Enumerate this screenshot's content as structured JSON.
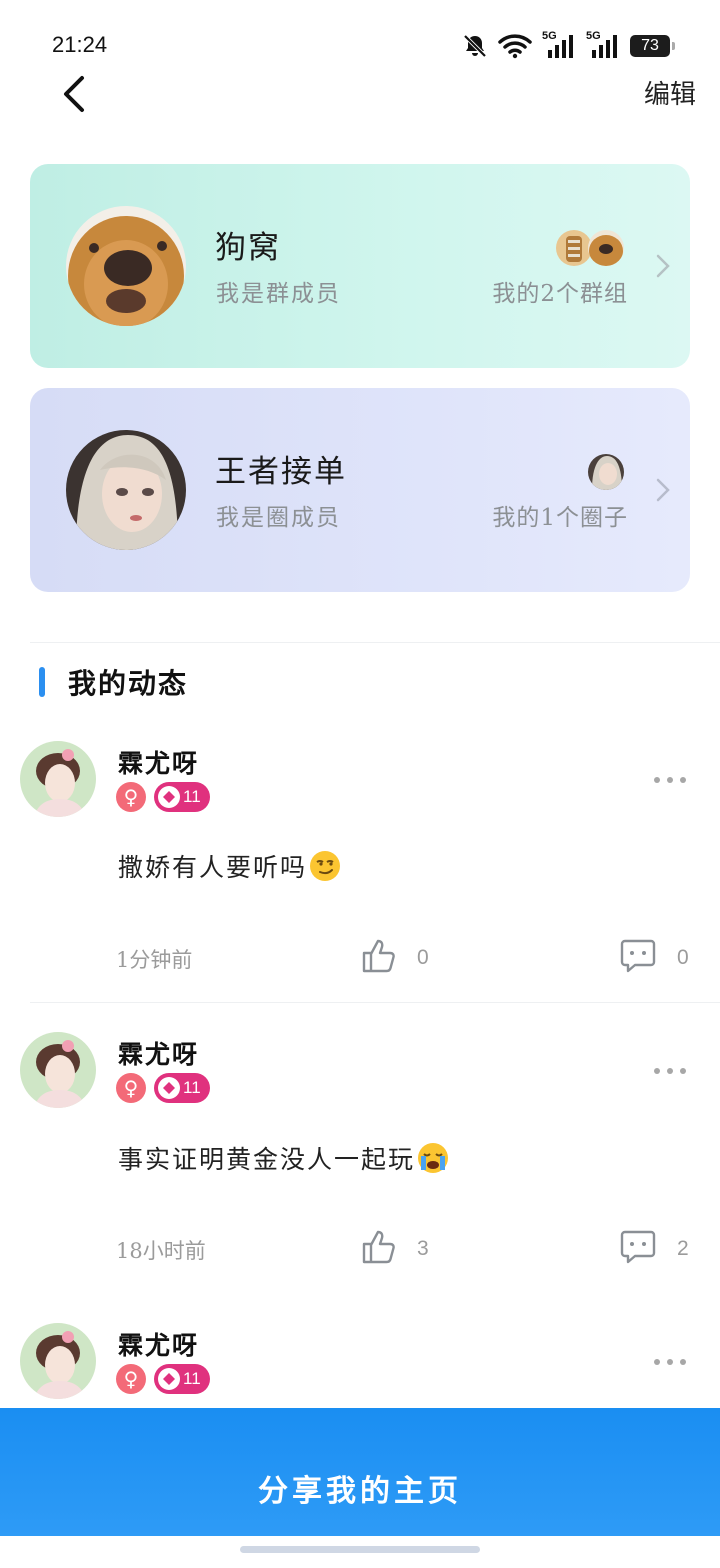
{
  "status_bar": {
    "time": "21:24",
    "signal_1": "5G",
    "signal_2": "5G",
    "battery": "73"
  },
  "header": {
    "edit_label": "编辑"
  },
  "group_card": {
    "title": "狗窝",
    "subtitle": "我是群成员",
    "right_label": "我的2个群组",
    "bg_color": "#c9f2ea"
  },
  "circle_card": {
    "title": "王者接单",
    "subtitle": "我是圈成员",
    "right_label": "我的1个圈子",
    "bg_color": "#dbe0f8"
  },
  "section": {
    "title": "我的动态",
    "accent": "#2b8ff0"
  },
  "posts": [
    {
      "user": "霖尤呀",
      "gender": "♀",
      "level": "11",
      "content": "撒娇有人要听吗",
      "emoji": "smirk-emoji",
      "time": "1分钟前",
      "likes": "0",
      "comments": "0"
    },
    {
      "user": "霖尤呀",
      "gender": "♀",
      "level": "11",
      "content": "事实证明黄金没人一起玩",
      "emoji": "crying-emoji",
      "time": "18小时前",
      "likes": "3",
      "comments": "2"
    },
    {
      "user": "霖尤呀",
      "gender": "♀",
      "level": "11"
    }
  ],
  "share_button": {
    "label": "分享我的主页",
    "color": "#1a8ef2"
  }
}
